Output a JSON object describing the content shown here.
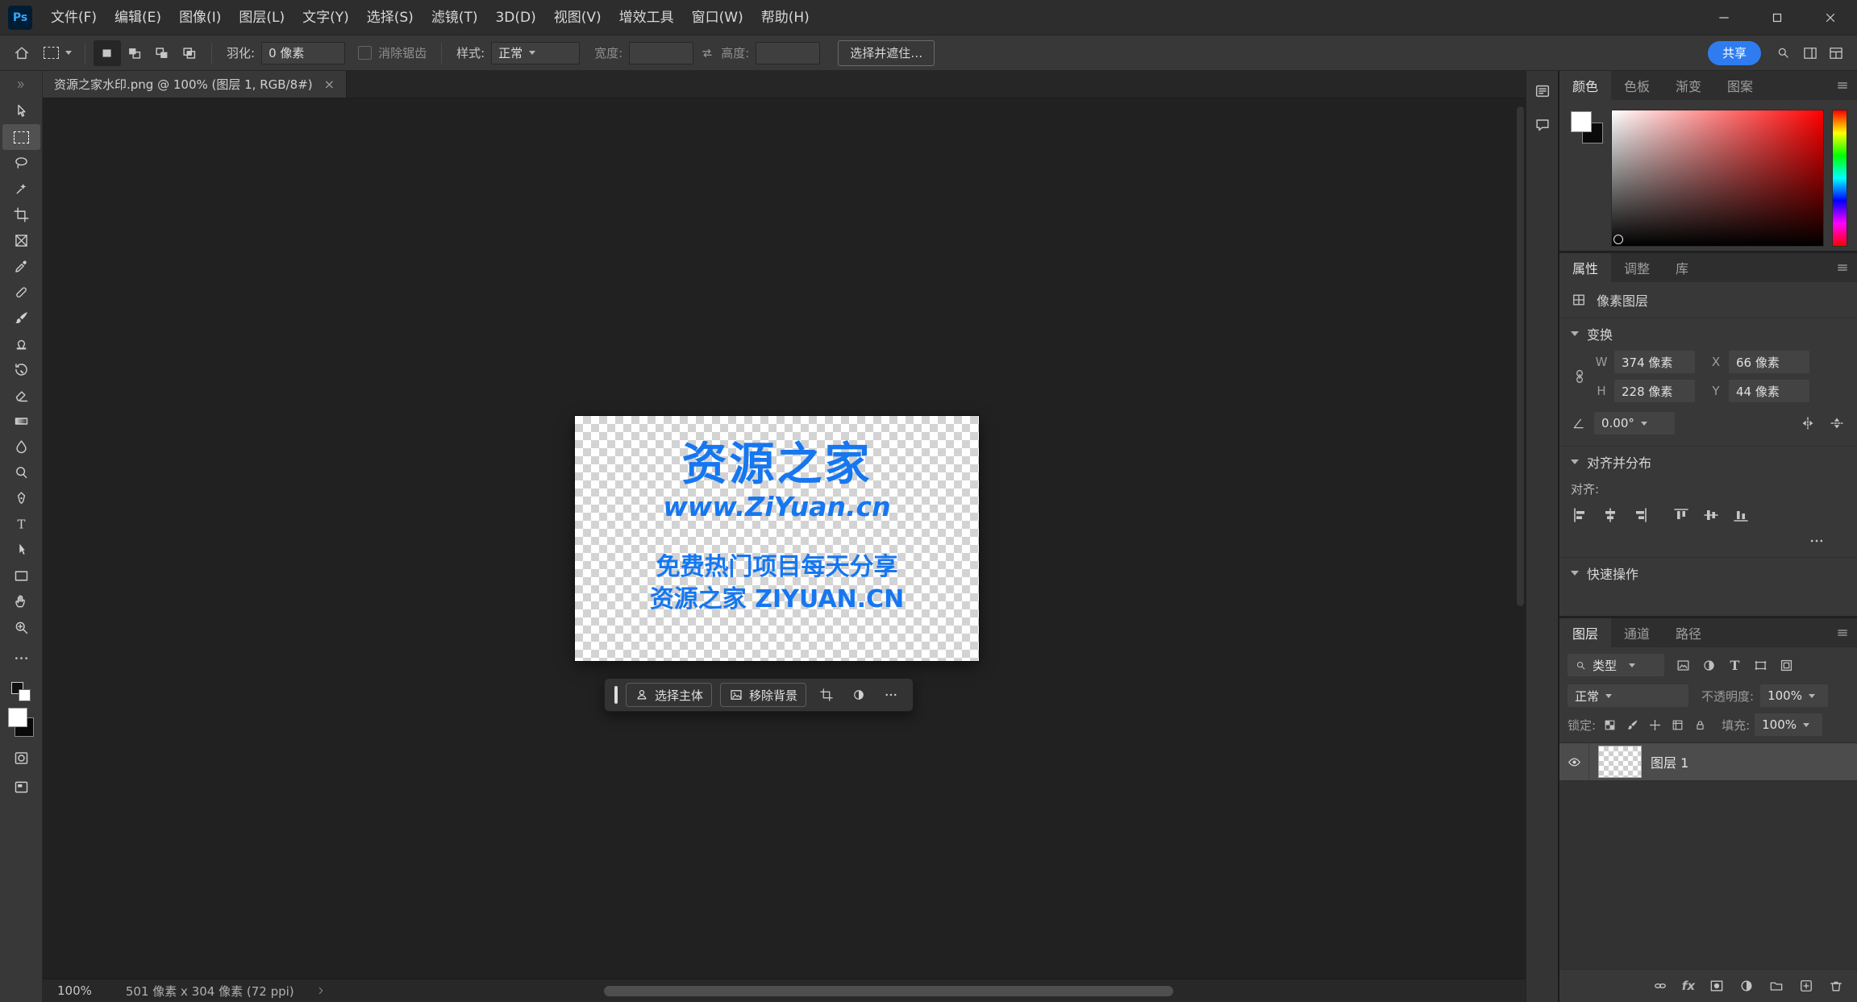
{
  "titlebar": {
    "menus": [
      "文件(F)",
      "编辑(E)",
      "图像(I)",
      "图层(L)",
      "文字(Y)",
      "选择(S)",
      "滤镜(T)",
      "3D(D)",
      "视图(V)",
      "增效工具",
      "窗口(W)",
      "帮助(H)"
    ]
  },
  "options_bar": {
    "feather_label": "羽化:",
    "feather_value": "0 像素",
    "anti_alias_label": "消除锯齿",
    "style_label": "样式:",
    "style_value": "正常",
    "width_label": "宽度:",
    "width_value": "",
    "height_label": "高度:",
    "height_value": "",
    "select_and_mask_button": "选择并遮住…",
    "share_button": "共享"
  },
  "document_tab": {
    "title": "资源之家水印.png @ 100% (图层 1, RGB/8#)",
    "close_label": "×"
  },
  "canvas": {
    "watermark": {
      "line1": "资源之家",
      "line2": "www.ZiYuan.cn",
      "line3": "免费热门项目每天分享",
      "line4": "资源之家 ZIYUAN.CN"
    },
    "task_bar": {
      "select_subject": "选择主体",
      "remove_background": "移除背景"
    }
  },
  "color_panel": {
    "tabs": [
      "颜色",
      "色板",
      "渐变",
      "图案"
    ]
  },
  "properties_panel": {
    "tabs": [
      "属性",
      "调整",
      "库"
    ],
    "layer_type": "像素图层",
    "transform": {
      "title": "变换",
      "w_label": "W",
      "w_value": "374 像素",
      "x_label": "X",
      "x_value": "66 像素",
      "h_label": "H",
      "h_value": "228 像素",
      "y_label": "Y",
      "y_value": "44 像素",
      "angle_value": "0.00°"
    },
    "align": {
      "title": "对齐并分布",
      "label": "对齐:"
    },
    "quick_actions": {
      "title": "快速操作"
    }
  },
  "layers_panel": {
    "tabs": [
      "图层",
      "通道",
      "路径"
    ],
    "filter_type": "类型",
    "blend_mode": "正常",
    "opacity_label": "不透明度:",
    "opacity_value": "100%",
    "lock_label": "锁定:",
    "fill_label": "填充:",
    "fill_value": "100%",
    "fx_label": "fx",
    "layers": [
      {
        "name": "图层 1"
      }
    ]
  },
  "status_bar": {
    "zoom_level": "100%",
    "document_size": "501 像素 x 304 像素 (72 ppi)"
  },
  "colors": {
    "share_button_blue": "#2e7cf0",
    "watermark_blue": "#1677f0",
    "photoshop_logo_blue": "#31a8ff"
  }
}
